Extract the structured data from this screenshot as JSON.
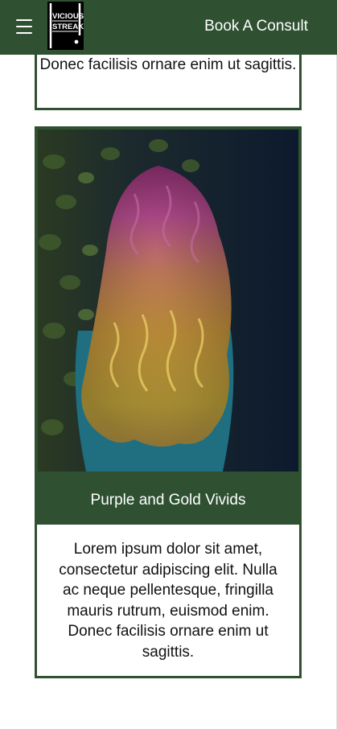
{
  "header": {
    "menu_icon": "hamburger-menu-icon",
    "logo_text_line1": "VICIOUS",
    "logo_text_line2": "STREAK",
    "cta_label": "Book A Consult",
    "background": "#2f5132"
  },
  "cards": [
    {
      "body": "Donec facilisis ornare enim ut sagittis."
    },
    {
      "image_alt": "Long curly hair with purple roots fading to gold",
      "title": "Purple and Gold Vivids",
      "body": "Lorem ipsum dolor sit amet, consectetur adipiscing elit. Nulla ac neque pellentesque, fringilla mauris rutrum, euismod enim. Donec facilisis ornare enim ut sagittis."
    }
  ],
  "colors": {
    "brand_green": "#2f5132",
    "text": "#111111",
    "white": "#ffffff"
  }
}
